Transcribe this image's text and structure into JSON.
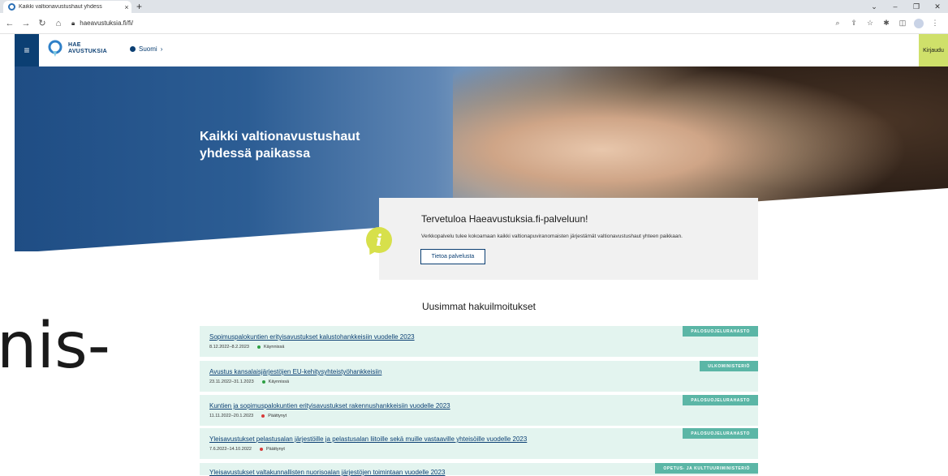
{
  "browser": {
    "tab_title": "Kaikki valtionavustushaut yhdess",
    "tab_close": "×",
    "new_tab": "+",
    "url": "haeavustuksia.fi/fi/",
    "win_controls": [
      "⌄",
      "–",
      "❐",
      "✕"
    ]
  },
  "site": {
    "menu_icon": "≡",
    "logo_line1": "HAE",
    "logo_line2": "AVUSTUKSIA",
    "language": "Suomi",
    "language_chevron": "›",
    "login": "Kirjaudu"
  },
  "hero": {
    "title_line1": "Kaikki valtionavustushaut",
    "title_line2": "yhdessä paikassa"
  },
  "welcome": {
    "icon": "i",
    "title": "Tervetuloa Haeavustuksia.fi-palveluun!",
    "text": "Verkkopalvelu tulee kokoamaan kaikki valtionapuviranomaisten järjestämät valtionavustushaut yhteen paikkaan.",
    "button": "Tietoa palvelusta"
  },
  "listings_title": "Uusimmat hakuilmoitukset",
  "listings": [
    {
      "title": "Sopimuspalokuntien erityisavustukset kalustohankkeisiin vuodelle 2023",
      "dates": "8.12.2022–8.2.2023",
      "status": "Käynnissä",
      "status_color": "#2ea043",
      "tag": "PALOSUOJELURAHASTO"
    },
    {
      "title": "Avustus kansalaisjärjestöjen EU-kehitysyhteistyöhankkeisiin",
      "dates": "23.11.2022–31.1.2023",
      "status": "Käynnissä",
      "status_color": "#2ea043",
      "tag": "ULKOMINISTERIÖ"
    },
    {
      "title": "Kuntien ja sopimuspalokuntien erityisavustukset rakennushankkeisiin vuodelle 2023",
      "dates": "11.11.2022–20.1.2023",
      "status": "Päättynyt",
      "status_color": "#d73a3a",
      "tag": "PALOSUOJELURAHASTO"
    },
    {
      "title": "Yleisavustukset pelastusalan järjestöille ja pelastusalan liitoille sekä muille vastaaville yhteisöille vuodelle 2023",
      "dates": "7.6.2022–14.10.2022",
      "status": "Päättynyt",
      "status_color": "#d73a3a",
      "tag": "PALOSUOJELURAHASTO"
    },
    {
      "title": "Yleisavustukset valtakunnallisten nuorisoalan järjestöjen toimintaan vuodelle 2023",
      "dates": "",
      "status": "",
      "status_color": "#2ea043",
      "tag": "OPETUS- JA KULTTUURIMINISTERIÖ"
    }
  ],
  "overlay_text": "nis-"
}
